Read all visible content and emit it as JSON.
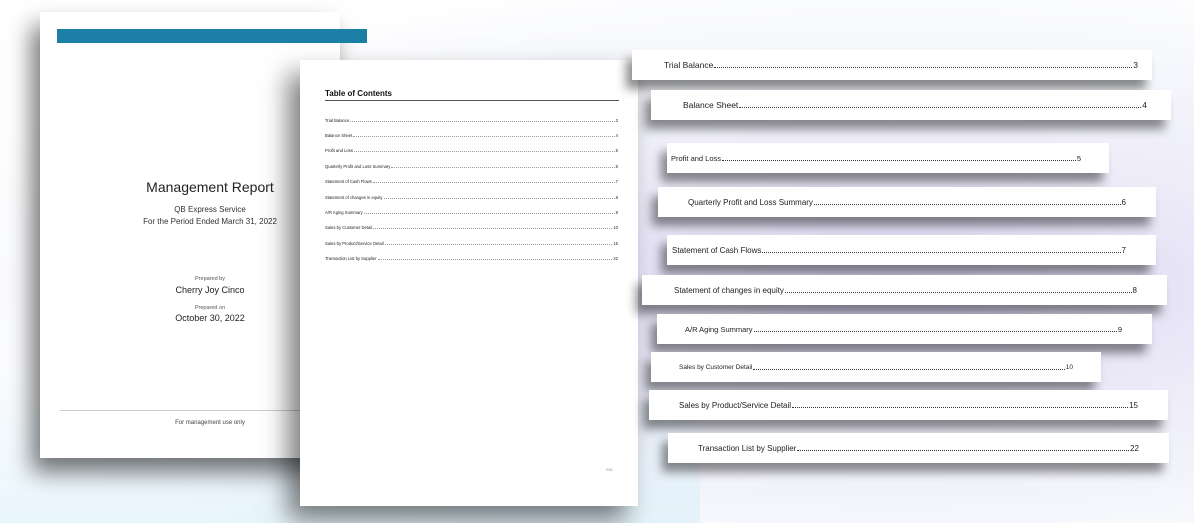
{
  "cover": {
    "title": "Management Report",
    "company": "QB Express Service",
    "period": "For the Period Ended March 31, 2022",
    "prepared_by_label": "Prepared by",
    "prepared_by": "Cherry Joy Cinco",
    "prepared_on_label": "Prepared on",
    "prepared_on": "October 30, 2022",
    "footer": "For management use only"
  },
  "toc": {
    "heading": "Table of Contents",
    "page_number": "2/31",
    "entries": [
      {
        "label": "Trial Balance",
        "page": "3"
      },
      {
        "label": "Balance Sheet",
        "page": "4"
      },
      {
        "label": "Profit and Loss",
        "page": "5"
      },
      {
        "label": "Quarterly Profit and Loss Summary",
        "page": "6"
      },
      {
        "label": "Statement of Cash Flows",
        "page": "7"
      },
      {
        "label": "Statement of changes in equity",
        "page": "8"
      },
      {
        "label": "A/R Aging Summary",
        "page": "9"
      },
      {
        "label": "Sales by  Customer Detail",
        "page": "10"
      },
      {
        "label": "Sales by  Product/Service Detail",
        "page": "15"
      },
      {
        "label": "Transaction List by  Supplier",
        "page": "22"
      }
    ]
  },
  "colors": {
    "accent_bar": "#1b7fa6"
  }
}
